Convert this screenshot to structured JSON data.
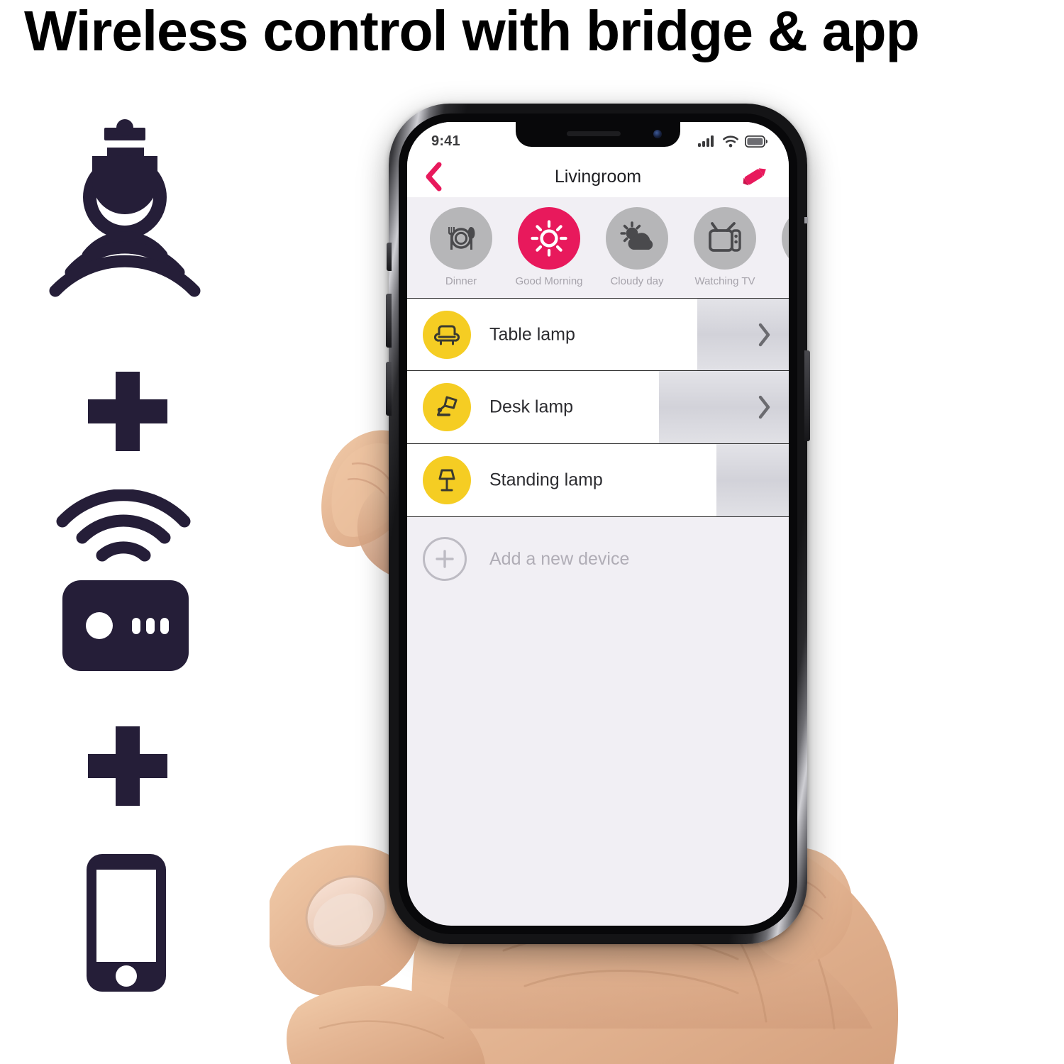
{
  "headline": {
    "text": "Wireless control with bridge & app"
  },
  "illustration": {
    "items": [
      {
        "icon": "smart-bulb-wireless-icon",
        "name": "smart-bulb"
      },
      {
        "icon": "plus-icon",
        "name": "plus-separator-1"
      },
      {
        "icon": "bridge-hub-wireless-icon",
        "name": "bridge"
      },
      {
        "icon": "plus-icon",
        "name": "plus-separator-2"
      },
      {
        "icon": "smartphone-icon",
        "name": "smartphone"
      }
    ]
  },
  "phone": {
    "statusbar": {
      "time": "9:41",
      "icons": [
        "cellular-signal-icon",
        "wifi-icon",
        "battery-icon"
      ]
    },
    "navbar": {
      "back_icon": "back-chevron-icon",
      "title": "Livingroom",
      "edit_icon": "pencil-edit-icon"
    },
    "scenes": [
      {
        "label": "Dinner",
        "icon": "cutlery-plate-icon",
        "active": false
      },
      {
        "label": "Good Morning",
        "icon": "sun-icon",
        "active": true
      },
      {
        "label": "Cloudy day",
        "icon": "sun-behind-cloud-icon",
        "active": false
      },
      {
        "label": "Watching TV",
        "icon": "television-icon",
        "active": false
      },
      {
        "label": "",
        "icon": "partial-scene-icon",
        "active": false
      }
    ],
    "devices": [
      {
        "name": "Table lamp",
        "icon": "armchair-icon",
        "brightness": 76,
        "chevron": true
      },
      {
        "name": "Desk lamp",
        "icon": "desk-lamp-icon",
        "brightness": 66,
        "chevron": true
      },
      {
        "name": "Standing lamp",
        "icon": "floor-lamp-icon",
        "brightness": 81,
        "chevron": false
      }
    ],
    "add_device": {
      "label": "Add a new device",
      "icon": "plus-circle-icon"
    }
  },
  "colors": {
    "accent_pink": "#e8195c",
    "lamp_yellow": "#f5cd23",
    "navy": "#251e38",
    "screen_bg": "#f1eff4",
    "scene_gray": "#b6b6b8",
    "slider_gray": "#d2d2d9"
  }
}
